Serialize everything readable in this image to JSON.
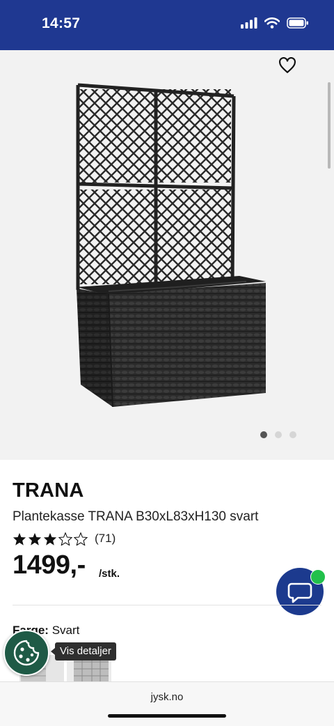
{
  "status_bar": {
    "time": "14:57",
    "icons": [
      "signal-icon",
      "wifi-icon",
      "battery-icon"
    ]
  },
  "gallery": {
    "slide_count": 3,
    "active_slide": 1,
    "favorite_icon": "heart-icon"
  },
  "product": {
    "brand": "TRANA",
    "name": "Plantekasse TRANA B30xL83xH130 svart",
    "rating": {
      "value": 3,
      "max": 5,
      "count": "(71)"
    },
    "price": "1499,-",
    "unit": "/stk."
  },
  "color_option": {
    "label": "Farge:",
    "value": "Svart"
  },
  "cookie_tooltip": "Vis detaljer",
  "chat": {
    "icon": "chat-icon",
    "online": true
  },
  "browser": {
    "url": "jysk.no"
  },
  "colors": {
    "brand_blue": "#1f3891",
    "chat_blue": "#1c3a8e",
    "online_green": "#22c04b",
    "cookie_green": "#1f5a46"
  }
}
